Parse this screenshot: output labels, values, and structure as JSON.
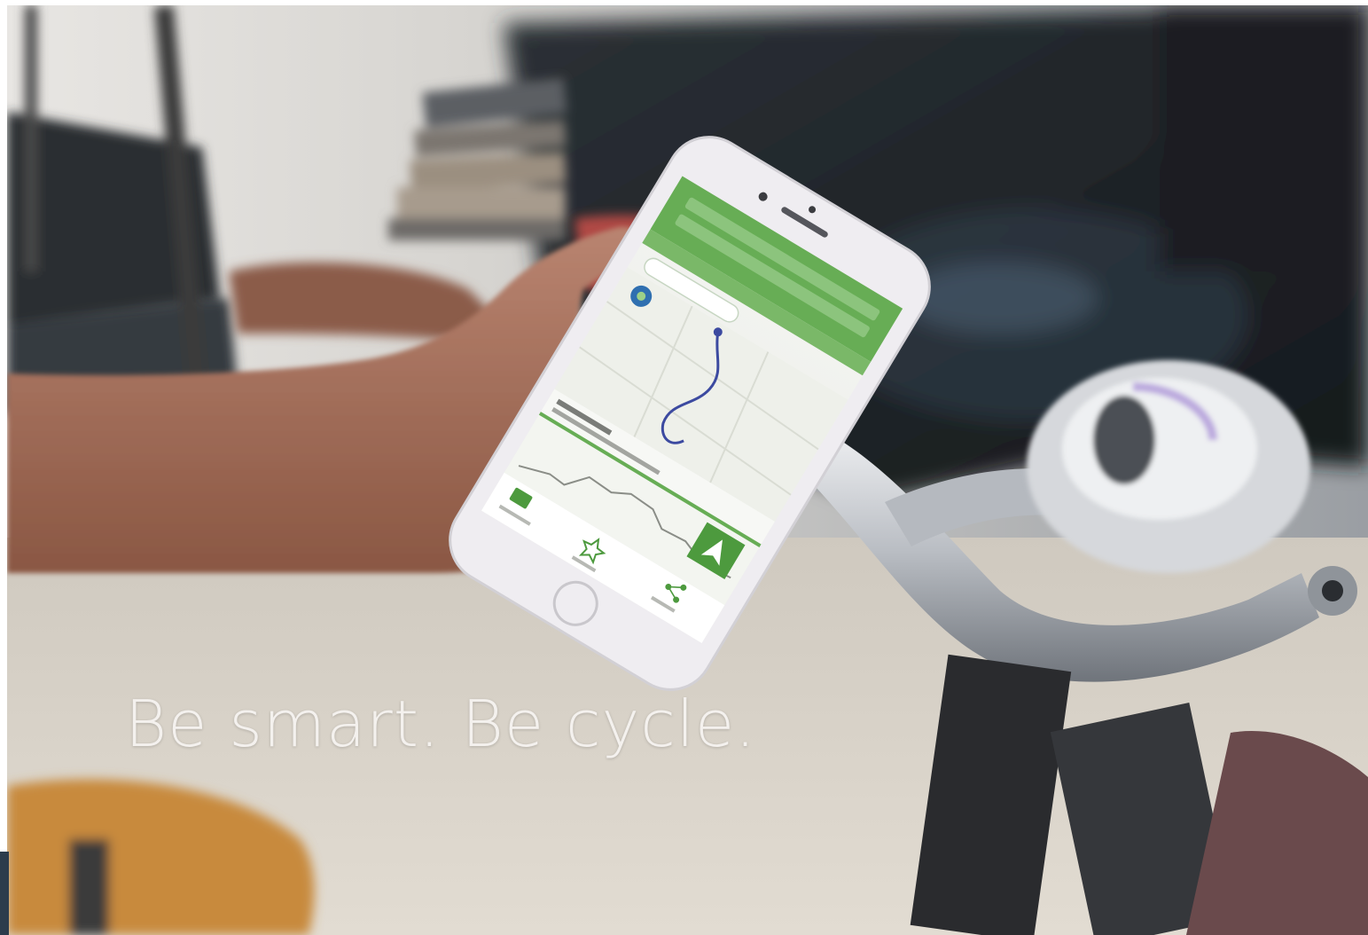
{
  "tagline": "Be smart. Be cycle.",
  "colors": {
    "brand_green": "#5aa54a",
    "phone_body": "#ebe9ee",
    "skin": "#a6705a",
    "chrome": "#c9ccd1",
    "sofa": "#1f2429",
    "floor": "#d8d2c8"
  },
  "icons": {
    "navigate": "navigation-arrow-icon",
    "location": "globe-marker-icon",
    "favorite": "star-icon",
    "share": "share-icon",
    "feedback": "thumbs-icon"
  }
}
